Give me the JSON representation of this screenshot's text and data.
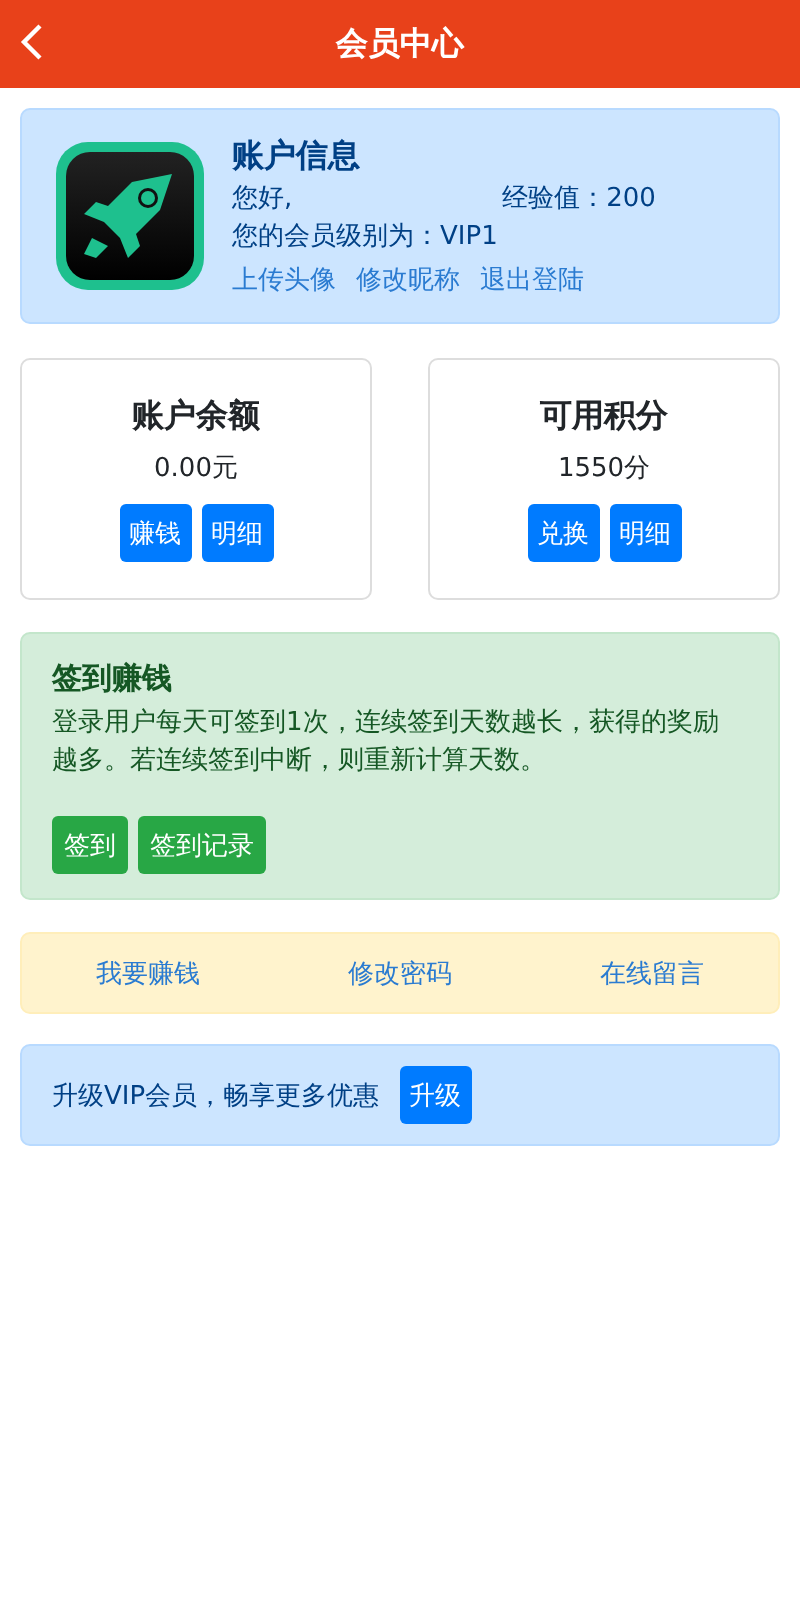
{
  "header": {
    "title": "会员中心"
  },
  "profile": {
    "title": "账户信息",
    "greeting": "您好,",
    "experience": "经验值：200",
    "level": "您的会员级别为：VIP1",
    "links": [
      "上传头像",
      "修改昵称",
      "退出登陆"
    ]
  },
  "stats": [
    {
      "title": "账户余额",
      "value": "0.00元",
      "buttons": [
        "赚钱",
        "明细"
      ]
    },
    {
      "title": "可用积分",
      "value": "1550分",
      "buttons": [
        "兑换",
        "明细"
      ]
    }
  ],
  "checkin": {
    "title": "签到赚钱",
    "text": "登录用户每天可签到1次，连续签到天数越长，获得的奖励越多。若连续签到中断，则重新计算天数。",
    "buttons": [
      "签到",
      "签到记录"
    ]
  },
  "links": [
    "我要赚钱",
    "修改密码",
    "在线留言"
  ],
  "upgrade": {
    "text": "升级VIP会员，畅享更多优惠",
    "button": "升级"
  }
}
